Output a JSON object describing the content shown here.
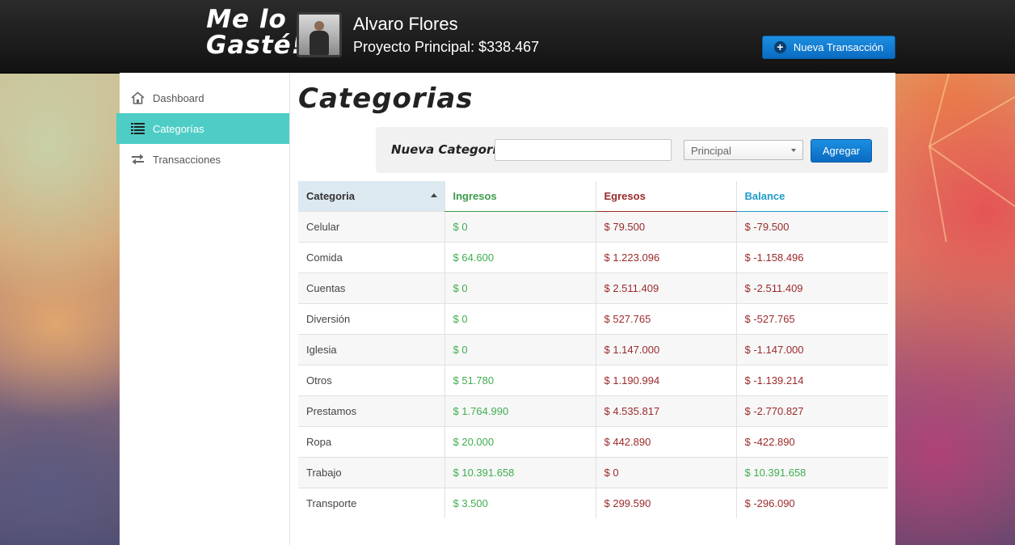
{
  "header": {
    "logo_line1": "Me lo",
    "logo_line2": "Gasté!",
    "user_name": "Alvaro Flores",
    "project_label": "Proyecto Principal: $338.467",
    "new_transaction_label": "Nueva Transacción"
  },
  "sidebar": {
    "items": [
      {
        "label": "Dashboard",
        "icon": "home-icon",
        "active": false
      },
      {
        "label": "Categorías",
        "icon": "list-icon",
        "active": true
      },
      {
        "label": "Transacciones",
        "icon": "exchange-icon",
        "active": false
      }
    ]
  },
  "main": {
    "title": "Categorias",
    "add_form": {
      "label": "Nueva Categoria:",
      "input_value": "",
      "select_value": "Principal",
      "button_label": "Agregar"
    },
    "table": {
      "headers": [
        "Categoria",
        "Ingresos",
        "Egresos",
        "Balance"
      ],
      "rows": [
        {
          "categoria": "Celular",
          "ingresos": "$ 0",
          "egresos": "$ 79.500",
          "balance": "$ -79.500",
          "positive": false
        },
        {
          "categoria": "Comida",
          "ingresos": "$ 64.600",
          "egresos": "$ 1.223.096",
          "balance": "$ -1.158.496",
          "positive": false
        },
        {
          "categoria": "Cuentas",
          "ingresos": "$ 0",
          "egresos": "$ 2.511.409",
          "balance": "$ -2.511.409",
          "positive": false
        },
        {
          "categoria": "Diversión",
          "ingresos": "$ 0",
          "egresos": "$ 527.765",
          "balance": "$ -527.765",
          "positive": false
        },
        {
          "categoria": "Iglesia",
          "ingresos": "$ 0",
          "egresos": "$ 1.147.000",
          "balance": "$ -1.147.000",
          "positive": false
        },
        {
          "categoria": "Otros",
          "ingresos": "$ 51.780",
          "egresos": "$ 1.190.994",
          "balance": "$ -1.139.214",
          "positive": false
        },
        {
          "categoria": "Prestamos",
          "ingresos": "$ 1.764.990",
          "egresos": "$ 4.535.817",
          "balance": "$ -2.770.827",
          "positive": false
        },
        {
          "categoria": "Ropa",
          "ingresos": "$ 20.000",
          "egresos": "$ 442.890",
          "balance": "$ -422.890",
          "positive": false
        },
        {
          "categoria": "Trabajo",
          "ingresos": "$ 10.391.658",
          "egresos": "$ 0",
          "balance": "$ 10.391.658",
          "positive": true
        },
        {
          "categoria": "Transporte",
          "ingresos": "$ 3.500",
          "egresos": "$ 299.590",
          "balance": "$ -296.090",
          "positive": false
        }
      ]
    }
  },
  "colors": {
    "accent_teal": "#4dcdc6",
    "button_blue": "#0a6bc2",
    "income_green": "#3fae4f",
    "expense_red": "#9b2a2a",
    "balance_blue": "#1f9ac9"
  }
}
